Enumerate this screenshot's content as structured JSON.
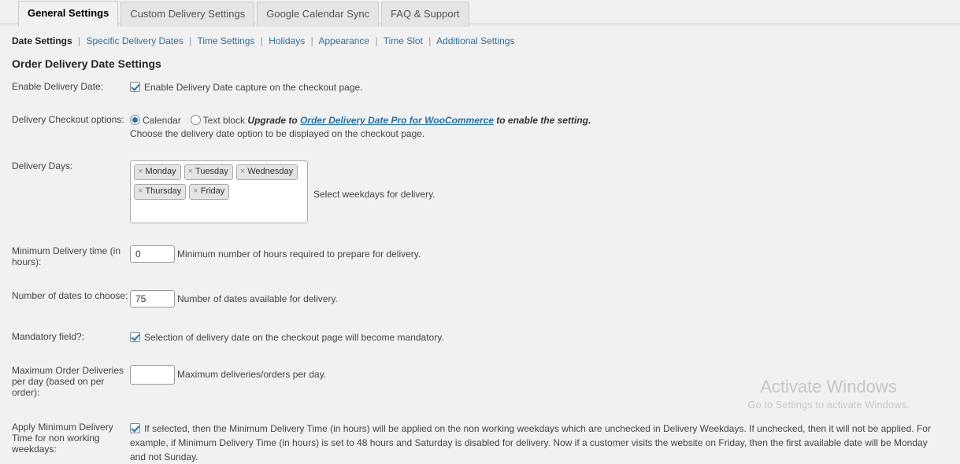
{
  "tabs": [
    {
      "label": "General Settings",
      "active": true
    },
    {
      "label": "Custom Delivery Settings",
      "active": false
    },
    {
      "label": "Google Calendar Sync",
      "active": false
    },
    {
      "label": "FAQ & Support",
      "active": false
    }
  ],
  "subnav": [
    {
      "label": "Date Settings",
      "current": true
    },
    {
      "label": "Specific Delivery Dates",
      "current": false
    },
    {
      "label": "Time Settings",
      "current": false
    },
    {
      "label": "Holidays",
      "current": false
    },
    {
      "label": "Appearance",
      "current": false
    },
    {
      "label": "Time Slot",
      "current": false
    },
    {
      "label": "Additional Settings",
      "current": false
    }
  ],
  "subnav_separator": "|",
  "page_title": "Order Delivery Date Settings",
  "settings": {
    "enable_delivery_date": {
      "label": "Enable Delivery Date:",
      "checked": true,
      "text": "Enable Delivery Date capture on the checkout page."
    },
    "checkout_options": {
      "label": "Delivery Checkout options:",
      "calendar_label": "Calendar",
      "calendar_selected": true,
      "textblock_label": "Text block",
      "textblock_selected": false,
      "upsell_prefix": "Upgrade to ",
      "upsell_link": "Order Delivery Date Pro for WooCommerce",
      "upsell_suffix": " to enable the setting.",
      "description": "Choose the delivery date option to be displayed on the checkout page."
    },
    "delivery_days": {
      "label": "Delivery Days:",
      "chips": [
        "Monday",
        "Tuesday",
        "Wednesday",
        "Thursday",
        "Friday"
      ],
      "chip_remove_glyph": "×",
      "help": "Select weekdays for delivery."
    },
    "minimum_delivery_time": {
      "label": "Minimum Delivery time (in hours):",
      "value": "0",
      "help": "Minimum number of hours required to prepare for delivery."
    },
    "number_of_dates": {
      "label": "Number of dates to choose:",
      "value": "75",
      "help": "Number of dates available for delivery."
    },
    "mandatory_field": {
      "label": "Mandatory field?:",
      "checked": true,
      "text": "Selection of delivery date on the checkout page will become mandatory."
    },
    "maximum_order_deliveries": {
      "label": "Maximum Order Deliveries per day (based on per order):",
      "value": "",
      "placeholder": "",
      "help": "Maximum deliveries/orders per day."
    },
    "apply_minimum_delivery_time": {
      "label": "Apply Minimum Delivery Time for non working weekdays:",
      "checked": true,
      "text": "If selected, then the Minimum Delivery Time (in hours) will be applied on the non working weekdays which are unchecked in Delivery Weekdays. If unchecked, then it will not be applied. For example, if Minimum Delivery Time (in hours) is set to 48 hours and Saturday is disabled for delivery. Now if a customer visits the website on Friday, then the first available date will be Monday and not Sunday."
    }
  },
  "watermark": {
    "title": "Activate Windows",
    "subtitle": "Go to Settings to activate Windows."
  },
  "colors": {
    "accent": "#2271b1",
    "background": "#f1f1f1",
    "tab_inactive": "#e5e5e5",
    "border": "#cccccc",
    "text": "#444444"
  }
}
